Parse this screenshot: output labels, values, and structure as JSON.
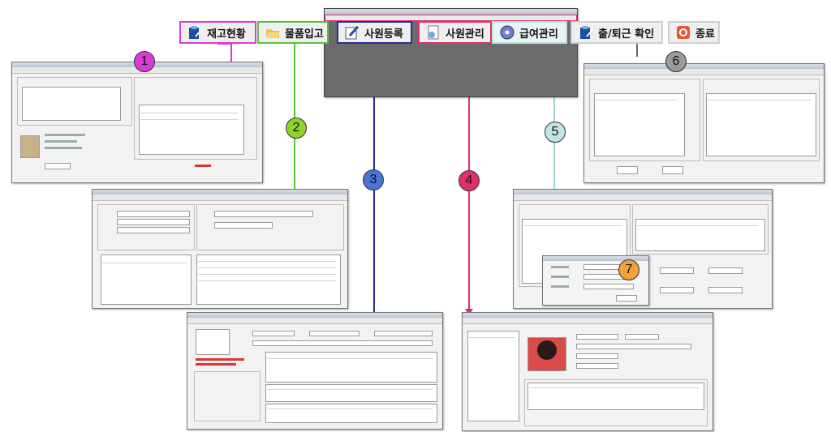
{
  "menu": {
    "buttons": [
      {
        "id": "inventory",
        "label": "재고현황",
        "icon": "clipboard-icon",
        "border": "#d93bd9"
      },
      {
        "id": "stock-in",
        "label": "물품입고",
        "icon": "folder-icon",
        "border": "#56c33a"
      },
      {
        "id": "staff-register",
        "label": "사원등록",
        "icon": "pencil-icon",
        "border": "#2a2a9a"
      },
      {
        "id": "staff-manage",
        "label": "사원관리",
        "icon": "document-icon",
        "border": "#e0306a"
      },
      {
        "id": "payroll",
        "label": "급여관리",
        "icon": "cd-icon",
        "border": "#b9e3e3"
      },
      {
        "id": "attendance",
        "label": "출/퇴근 확인",
        "icon": "clipboard-icon",
        "border": "#c8c8c8"
      },
      {
        "id": "exit",
        "label": "종료",
        "icon": "exit-icon",
        "border": "#c8c8c8"
      }
    ]
  },
  "markers": [
    {
      "label": "1",
      "color": "#d93bd9"
    },
    {
      "label": "2",
      "color": "#8fd22a"
    },
    {
      "label": "3",
      "color": "#4a74d6"
    },
    {
      "label": "4",
      "color": "#e0306a"
    },
    {
      "label": "5",
      "color": "#bfe6e6"
    },
    {
      "label": "6",
      "color": "#9a9a9a"
    },
    {
      "label": "7",
      "color": "#f2a23a"
    }
  ]
}
